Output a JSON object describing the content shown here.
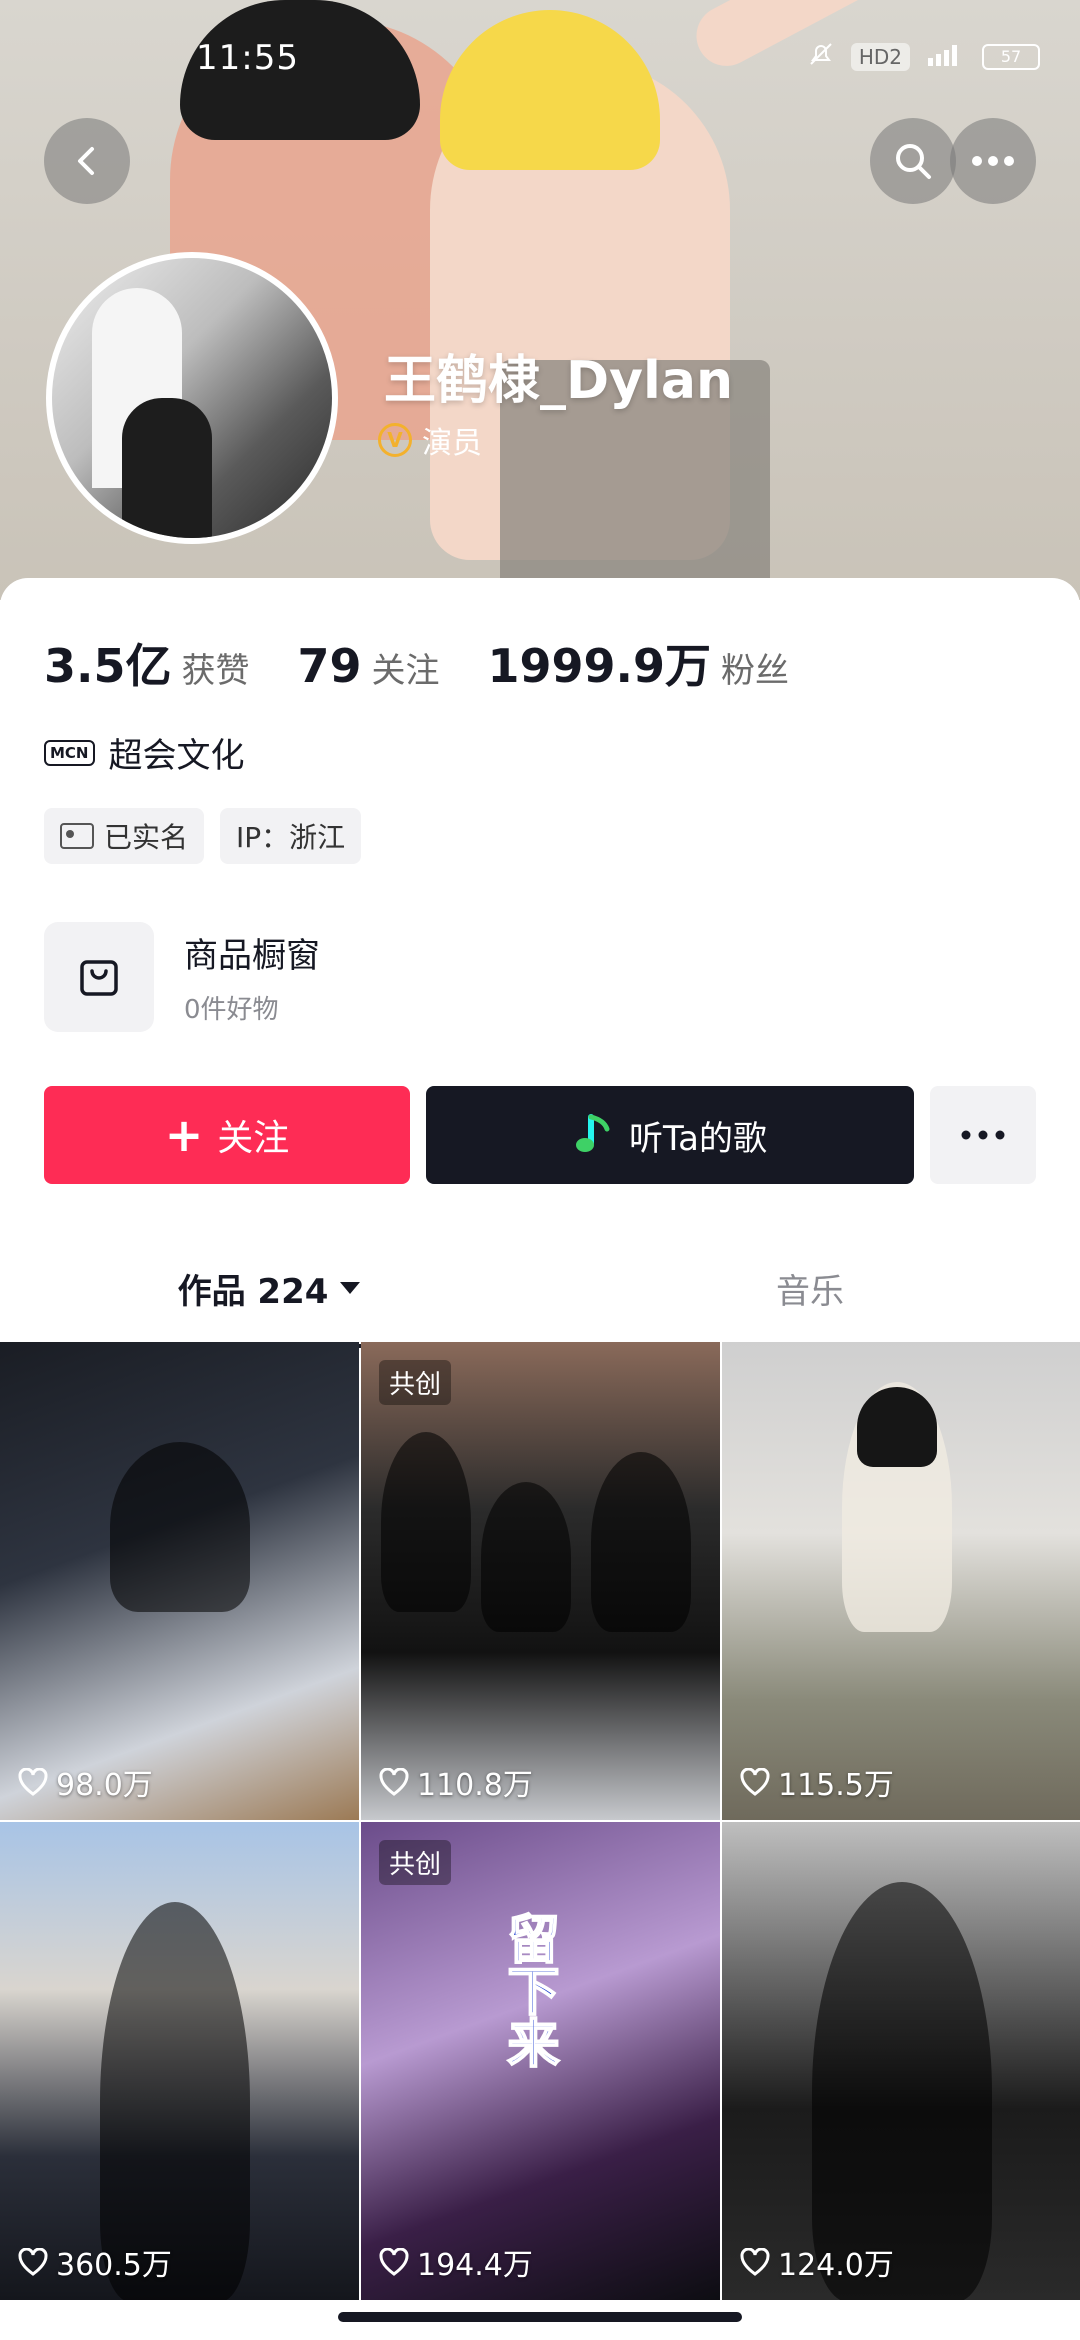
{
  "status_bar": {
    "time": "11:55",
    "hd": "HD2",
    "battery": "57"
  },
  "profile": {
    "name": "王鹤棣_Dylan",
    "verified_role": "演员",
    "verified_mark": "V"
  },
  "stats": [
    {
      "value": "3.5亿",
      "label": "获赞"
    },
    {
      "value": "79",
      "label": "关注"
    },
    {
      "value": "1999.9万",
      "label": "粉丝"
    }
  ],
  "mcn": {
    "badge": "MCN",
    "name": "超会文化"
  },
  "tags": [
    {
      "label": "已实名"
    },
    {
      "label": "IP：浙江"
    }
  ],
  "shop": {
    "title": "商品橱窗",
    "subtitle": "0件好物"
  },
  "actions": {
    "follow": "关注",
    "follow_icon": "+",
    "music": "听Ta的歌"
  },
  "tabs": [
    {
      "label": "作品 224",
      "active": true
    },
    {
      "label": "音乐",
      "active": false
    }
  ],
  "videos": [
    {
      "likes": "98.0万",
      "tag": ""
    },
    {
      "likes": "110.8万",
      "tag": "共创"
    },
    {
      "likes": "115.5万",
      "tag": ""
    },
    {
      "likes": "360.5万",
      "tag": ""
    },
    {
      "likes": "194.4万",
      "tag": "共创",
      "overlay": "留下来"
    },
    {
      "likes": "124.0万",
      "tag": ""
    }
  ],
  "colors": {
    "accent": "#fe2c55",
    "dark": "#161823",
    "verified": "#f3b12d"
  }
}
